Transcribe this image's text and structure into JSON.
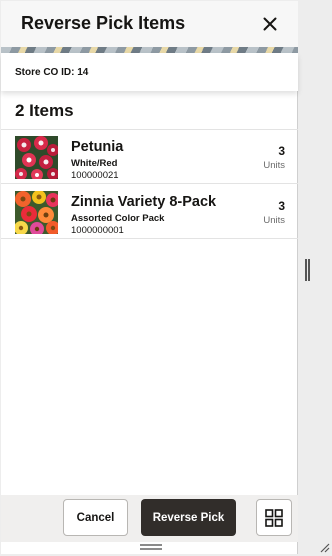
{
  "header": {
    "title": "Reverse Pick Items",
    "close_icon": "close-icon"
  },
  "store": {
    "label": "Store CO ID: 14"
  },
  "list": {
    "count_label": "2 Items",
    "items": [
      {
        "name": "Petunia",
        "variant": "White/Red",
        "sku": "100000021",
        "quantity": "3",
        "unit": "Units",
        "image_icon": "petunia-flower-image"
      },
      {
        "name": "Zinnia Variety 8-Pack",
        "variant": "Assorted Color Pack",
        "sku": "1000000001",
        "quantity": "3",
        "unit": "Units",
        "image_icon": "zinnia-flowers-image"
      }
    ]
  },
  "footer": {
    "cancel_label": "Cancel",
    "reverse_pick_label": "Reverse Pick",
    "grid_icon": "grid-icon"
  },
  "colors": {
    "primary_button": "#312d2a",
    "text": "#161513",
    "secondary_text": "#6b6b6b",
    "footer_bg": "#f0efee"
  }
}
